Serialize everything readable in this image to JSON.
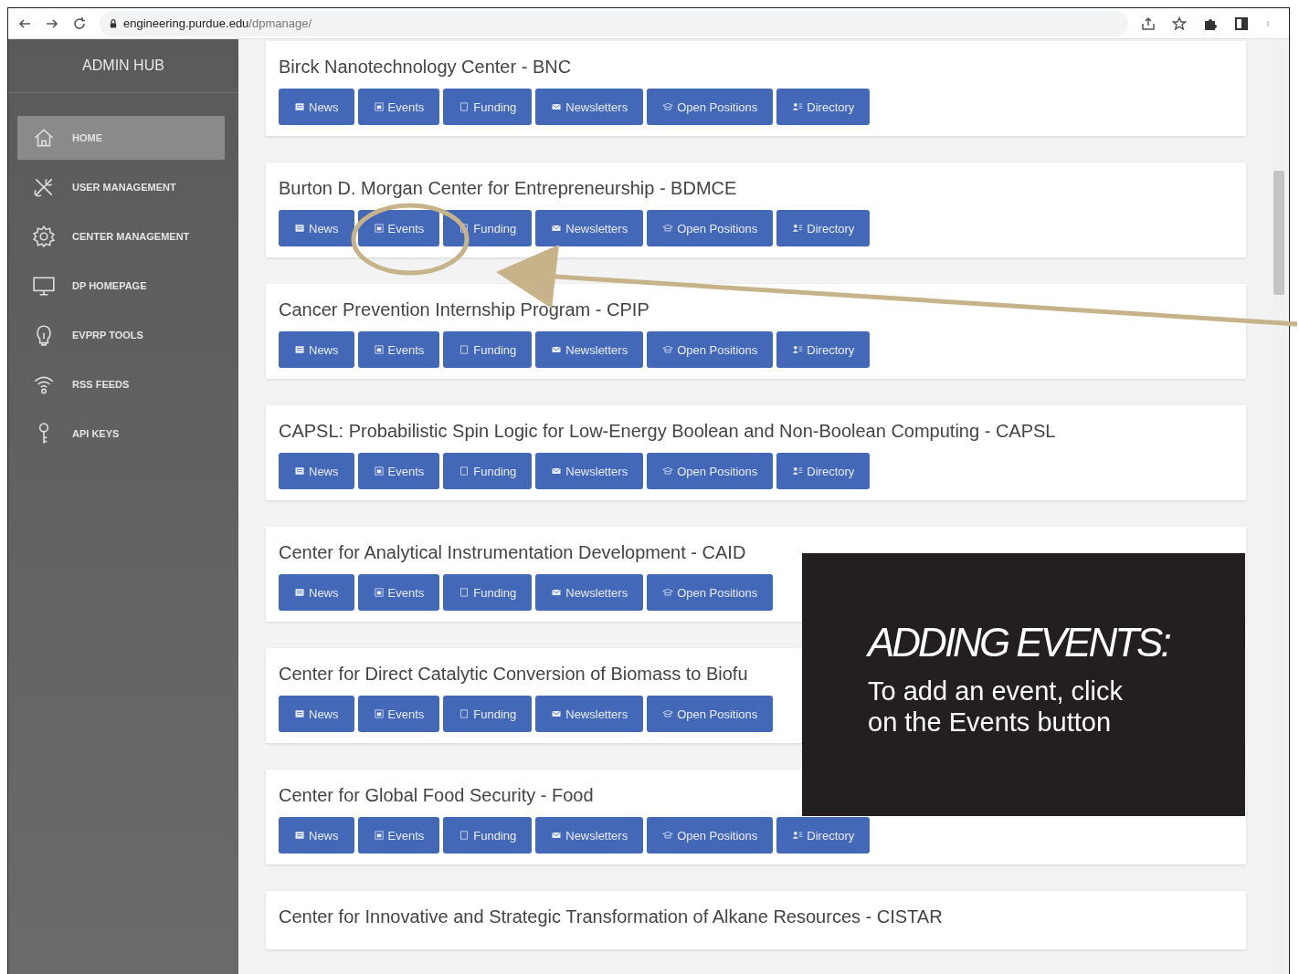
{
  "browser": {
    "url_host": "engineering.purdue.edu",
    "url_path": "/dpmanage/"
  },
  "sidebar": {
    "title": "ADMIN HUB",
    "items": [
      {
        "label": "HOME",
        "selected": true
      },
      {
        "label": "USER MANAGEMENT",
        "selected": false
      },
      {
        "label": "CENTER MANAGEMENT",
        "selected": false
      },
      {
        "label": "DP HOMEPAGE",
        "selected": false
      },
      {
        "label": "EVPRP TOOLS",
        "selected": false
      },
      {
        "label": "RSS FEEDS",
        "selected": false
      },
      {
        "label": "API KEYS",
        "selected": false
      }
    ]
  },
  "centers": [
    {
      "title": "Birck Nanotechnology Center - BNC",
      "buttons": [
        "News",
        "Events",
        "Funding",
        "Newsletters",
        "Open Positions",
        "Directory"
      ]
    },
    {
      "title": "Burton D. Morgan Center for Entrepreneurship - BDMCE",
      "buttons": [
        "News",
        "Events",
        "Funding",
        "Newsletters",
        "Open Positions",
        "Directory"
      ]
    },
    {
      "title": "Cancer Prevention Internship Program - CPIP",
      "buttons": [
        "News",
        "Events",
        "Funding",
        "Newsletters",
        "Open Positions",
        "Directory"
      ]
    },
    {
      "title": "CAPSL: Probabilistic Spin Logic for Low-Energy Boolean and Non-Boolean Computing - CAPSL",
      "buttons": [
        "News",
        "Events",
        "Funding",
        "Newsletters",
        "Open Positions",
        "Directory"
      ]
    },
    {
      "title": "Center for Analytical Instrumentation Development - CAID",
      "buttons": [
        "News",
        "Events",
        "Funding",
        "Newsletters",
        "Open Positions"
      ]
    },
    {
      "title": "Center for Direct Catalytic Conversion of Biomass to Biofu",
      "buttons": [
        "News",
        "Events",
        "Funding",
        "Newsletters",
        "Open Positions"
      ]
    },
    {
      "title": "Center for Global Food Security - Food",
      "buttons": [
        "News",
        "Events",
        "Funding",
        "Newsletters",
        "Open Positions",
        "Directory"
      ]
    },
    {
      "title": "Center for Innovative and Strategic Transformation of Alkane Resources - CISTAR"
    }
  ],
  "callout": {
    "title": "ADDING EVENTS:",
    "body": "To add an event, click\non the Events button"
  }
}
